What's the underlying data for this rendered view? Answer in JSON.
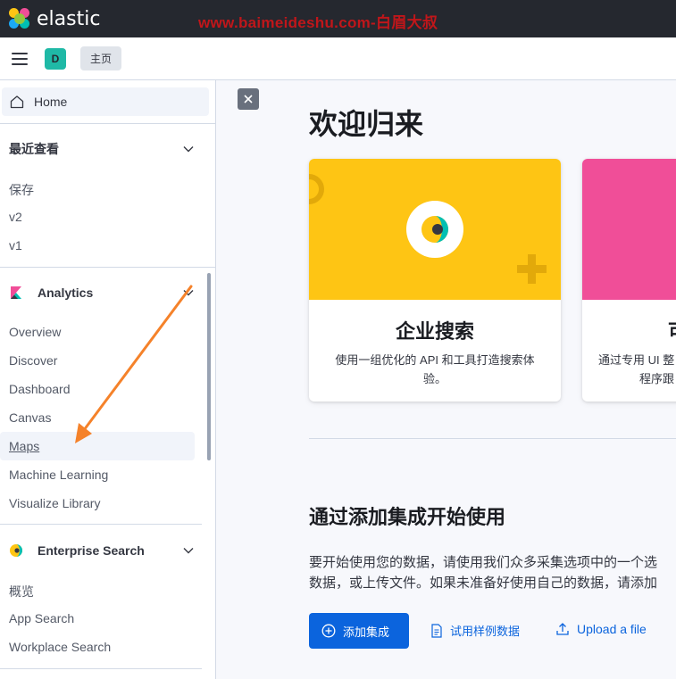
{
  "app": {
    "name": "elastic",
    "watermark": "www.baimeideshu.com-白眉大叔"
  },
  "header": {
    "space_initial": "D",
    "breadcrumb": "主页"
  },
  "sidebar": {
    "home": "Home",
    "recent": {
      "title": "最近查看",
      "items": [
        "保存",
        "v2",
        "v1"
      ]
    },
    "analytics": {
      "title": "Analytics",
      "items": [
        "Overview",
        "Discover",
        "Dashboard",
        "Canvas",
        "Maps",
        "Machine Learning",
        "Visualize Library"
      ]
    },
    "enterprise": {
      "title": "Enterprise Search",
      "items": [
        "概览",
        "App Search",
        "Workplace Search"
      ]
    }
  },
  "main": {
    "welcome": "欢迎归来",
    "cards": [
      {
        "title": "企业搜索",
        "desc_line1": "使用一组优化的 API 和工具打造搜索体",
        "desc_line2": "验。",
        "color": "#fec514"
      },
      {
        "title": "可",
        "desc_line1": "通过专用 UI 整",
        "desc_line2": "程序跟",
        "color": "#f04e98"
      }
    ],
    "section_title": "通过添加集成开始使用",
    "para_line1": "要开始使用您的数据，请使用我们众多采集选项中的一个选",
    "para_line2": "数据，或上传文件。如果未准备好使用自己的数据，请添加",
    "add_integration": "添加集成",
    "sample_data": "试用样例数据",
    "upload_file": "Upload a file"
  },
  "colors": {
    "topbar": "#25282f",
    "primary": "#0b64dd",
    "accent_orange": "#f5822a"
  }
}
